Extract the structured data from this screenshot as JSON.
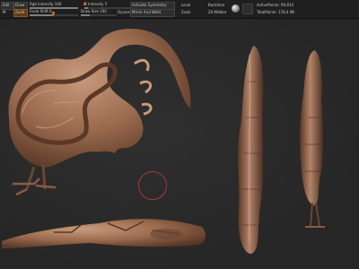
{
  "toolbar": {
    "row1": {
      "mode_a": "Edit",
      "mode_b": "Draw",
      "rgb_intensity": "Rgb Intensity 100",
      "z_intensity": "Z Intensity 5",
      "sym_label": "Activate Symmetry",
      "local_label": "Local",
      "backface_label": "Backface",
      "active_points": "ActivePoints: 99,814",
      "brush_icon": "clay-brush-icon"
    },
    "row2": {
      "tool_a": "M",
      "tool_b": "Zadd",
      "focal_shift": "Focal Shift 0",
      "draw_size": "Draw Size 100",
      "dynamic": "Dynamic",
      "mirror_weld": "Mirror And Weld",
      "zrem": "Zsub",
      "total_points": "TotalPoints: 178,4 Mil"
    }
  },
  "viewport": {
    "theme": {
      "clay": "#9a6a4e",
      "clay_dark": "#5a3826",
      "clay_light": "#c4957a",
      "background": "#2a2a2a"
    }
  }
}
